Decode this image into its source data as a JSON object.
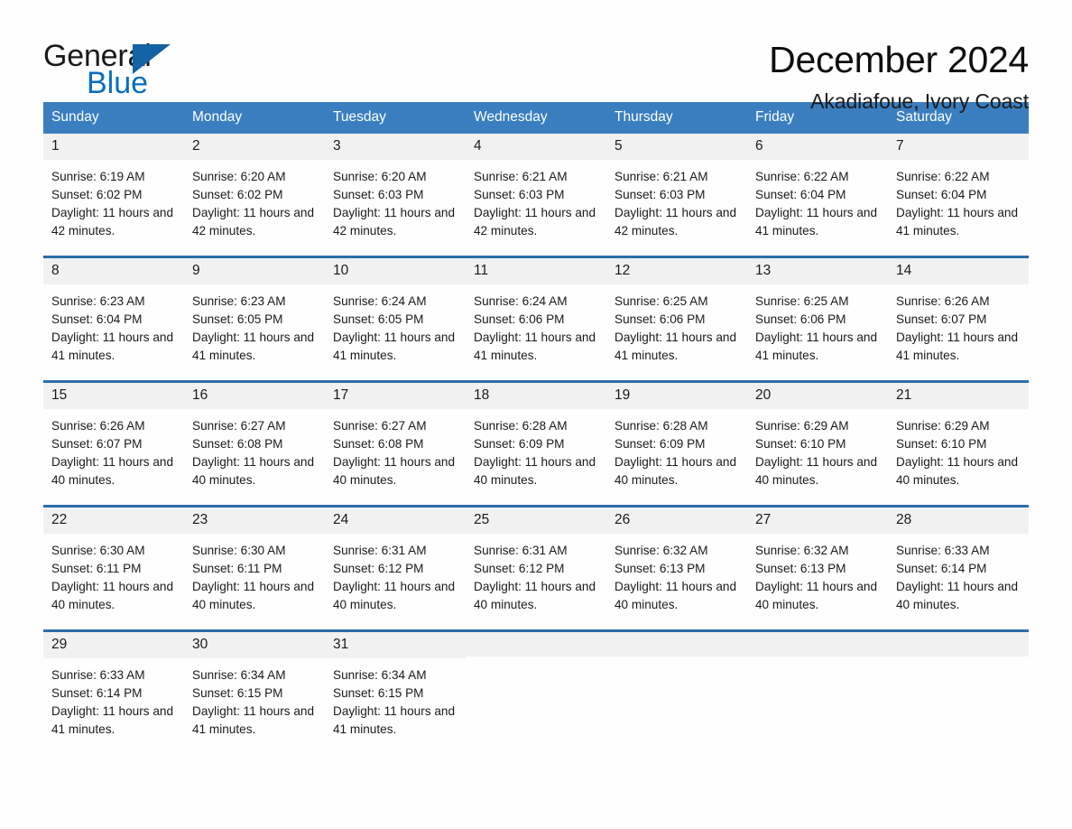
{
  "brand": {
    "name_part1": "General",
    "name_part2": "Blue",
    "triangle_color": "#1463a5",
    "blue_color": "#0a6ebd"
  },
  "header": {
    "title": "December 2024",
    "subtitle": "Akadiafoue, Ivory Coast"
  },
  "theme": {
    "header_band": "#3a7ebf",
    "week_divider": "#2e6da8",
    "daynum_strip": "#f1f1f1",
    "text": "#1a1a1a"
  },
  "weekdays": [
    "Sunday",
    "Monday",
    "Tuesday",
    "Wednesday",
    "Thursday",
    "Friday",
    "Saturday"
  ],
  "weeks": [
    [
      {
        "day": "1",
        "sunrise": "Sunrise: 6:19 AM",
        "sunset": "Sunset: 6:02 PM",
        "daylight": "Daylight: 11 hours and 42 minutes."
      },
      {
        "day": "2",
        "sunrise": "Sunrise: 6:20 AM",
        "sunset": "Sunset: 6:02 PM",
        "daylight": "Daylight: 11 hours and 42 minutes."
      },
      {
        "day": "3",
        "sunrise": "Sunrise: 6:20 AM",
        "sunset": "Sunset: 6:03 PM",
        "daylight": "Daylight: 11 hours and 42 minutes."
      },
      {
        "day": "4",
        "sunrise": "Sunrise: 6:21 AM",
        "sunset": "Sunset: 6:03 PM",
        "daylight": "Daylight: 11 hours and 42 minutes."
      },
      {
        "day": "5",
        "sunrise": "Sunrise: 6:21 AM",
        "sunset": "Sunset: 6:03 PM",
        "daylight": "Daylight: 11 hours and 42 minutes."
      },
      {
        "day": "6",
        "sunrise": "Sunrise: 6:22 AM",
        "sunset": "Sunset: 6:04 PM",
        "daylight": "Daylight: 11 hours and 41 minutes."
      },
      {
        "day": "7",
        "sunrise": "Sunrise: 6:22 AM",
        "sunset": "Sunset: 6:04 PM",
        "daylight": "Daylight: 11 hours and 41 minutes."
      }
    ],
    [
      {
        "day": "8",
        "sunrise": "Sunrise: 6:23 AM",
        "sunset": "Sunset: 6:04 PM",
        "daylight": "Daylight: 11 hours and 41 minutes."
      },
      {
        "day": "9",
        "sunrise": "Sunrise: 6:23 AM",
        "sunset": "Sunset: 6:05 PM",
        "daylight": "Daylight: 11 hours and 41 minutes."
      },
      {
        "day": "10",
        "sunrise": "Sunrise: 6:24 AM",
        "sunset": "Sunset: 6:05 PM",
        "daylight": "Daylight: 11 hours and 41 minutes."
      },
      {
        "day": "11",
        "sunrise": "Sunrise: 6:24 AM",
        "sunset": "Sunset: 6:06 PM",
        "daylight": "Daylight: 11 hours and 41 minutes."
      },
      {
        "day": "12",
        "sunrise": "Sunrise: 6:25 AM",
        "sunset": "Sunset: 6:06 PM",
        "daylight": "Daylight: 11 hours and 41 minutes."
      },
      {
        "day": "13",
        "sunrise": "Sunrise: 6:25 AM",
        "sunset": "Sunset: 6:06 PM",
        "daylight": "Daylight: 11 hours and 41 minutes."
      },
      {
        "day": "14",
        "sunrise": "Sunrise: 6:26 AM",
        "sunset": "Sunset: 6:07 PM",
        "daylight": "Daylight: 11 hours and 41 minutes."
      }
    ],
    [
      {
        "day": "15",
        "sunrise": "Sunrise: 6:26 AM",
        "sunset": "Sunset: 6:07 PM",
        "daylight": "Daylight: 11 hours and 40 minutes."
      },
      {
        "day": "16",
        "sunrise": "Sunrise: 6:27 AM",
        "sunset": "Sunset: 6:08 PM",
        "daylight": "Daylight: 11 hours and 40 minutes."
      },
      {
        "day": "17",
        "sunrise": "Sunrise: 6:27 AM",
        "sunset": "Sunset: 6:08 PM",
        "daylight": "Daylight: 11 hours and 40 minutes."
      },
      {
        "day": "18",
        "sunrise": "Sunrise: 6:28 AM",
        "sunset": "Sunset: 6:09 PM",
        "daylight": "Daylight: 11 hours and 40 minutes."
      },
      {
        "day": "19",
        "sunrise": "Sunrise: 6:28 AM",
        "sunset": "Sunset: 6:09 PM",
        "daylight": "Daylight: 11 hours and 40 minutes."
      },
      {
        "day": "20",
        "sunrise": "Sunrise: 6:29 AM",
        "sunset": "Sunset: 6:10 PM",
        "daylight": "Daylight: 11 hours and 40 minutes."
      },
      {
        "day": "21",
        "sunrise": "Sunrise: 6:29 AM",
        "sunset": "Sunset: 6:10 PM",
        "daylight": "Daylight: 11 hours and 40 minutes."
      }
    ],
    [
      {
        "day": "22",
        "sunrise": "Sunrise: 6:30 AM",
        "sunset": "Sunset: 6:11 PM",
        "daylight": "Daylight: 11 hours and 40 minutes."
      },
      {
        "day": "23",
        "sunrise": "Sunrise: 6:30 AM",
        "sunset": "Sunset: 6:11 PM",
        "daylight": "Daylight: 11 hours and 40 minutes."
      },
      {
        "day": "24",
        "sunrise": "Sunrise: 6:31 AM",
        "sunset": "Sunset: 6:12 PM",
        "daylight": "Daylight: 11 hours and 40 minutes."
      },
      {
        "day": "25",
        "sunrise": "Sunrise: 6:31 AM",
        "sunset": "Sunset: 6:12 PM",
        "daylight": "Daylight: 11 hours and 40 minutes."
      },
      {
        "day": "26",
        "sunrise": "Sunrise: 6:32 AM",
        "sunset": "Sunset: 6:13 PM",
        "daylight": "Daylight: 11 hours and 40 minutes."
      },
      {
        "day": "27",
        "sunrise": "Sunrise: 6:32 AM",
        "sunset": "Sunset: 6:13 PM",
        "daylight": "Daylight: 11 hours and 40 minutes."
      },
      {
        "day": "28",
        "sunrise": "Sunrise: 6:33 AM",
        "sunset": "Sunset: 6:14 PM",
        "daylight": "Daylight: 11 hours and 40 minutes."
      }
    ],
    [
      {
        "day": "29",
        "sunrise": "Sunrise: 6:33 AM",
        "sunset": "Sunset: 6:14 PM",
        "daylight": "Daylight: 11 hours and 41 minutes."
      },
      {
        "day": "30",
        "sunrise": "Sunrise: 6:34 AM",
        "sunset": "Sunset: 6:15 PM",
        "daylight": "Daylight: 11 hours and 41 minutes."
      },
      {
        "day": "31",
        "sunrise": "Sunrise: 6:34 AM",
        "sunset": "Sunset: 6:15 PM",
        "daylight": "Daylight: 11 hours and 41 minutes."
      },
      {
        "day": "",
        "sunrise": "",
        "sunset": "",
        "daylight": ""
      },
      {
        "day": "",
        "sunrise": "",
        "sunset": "",
        "daylight": ""
      },
      {
        "day": "",
        "sunrise": "",
        "sunset": "",
        "daylight": ""
      },
      {
        "day": "",
        "sunrise": "",
        "sunset": "",
        "daylight": ""
      }
    ]
  ]
}
